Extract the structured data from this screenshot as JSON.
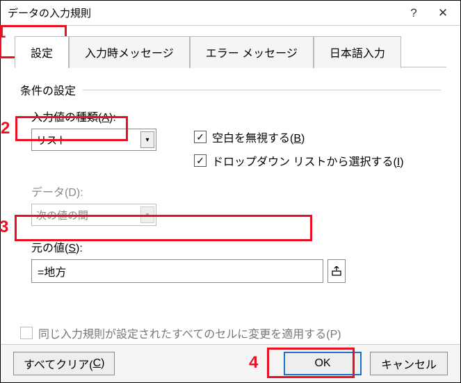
{
  "window": {
    "title": "データの入力規則"
  },
  "tabs": {
    "t1": "設定",
    "t2": "入力時メッセージ",
    "t3": "エラー メッセージ",
    "t4": "日本語入力"
  },
  "fieldset": {
    "legend": "条件の設定",
    "allow_label_pre": "入力値の種類(",
    "allow_label_key": "A",
    "allow_label_post": "):",
    "allow_value": "リスト",
    "data_label_pre": "データ(",
    "data_label_key": "D",
    "data_label_post": "):",
    "data_value": "次の値の間",
    "ignore_blank_pre": "空白を無視する(",
    "ignore_blank_key": "B",
    "ignore_blank_post": ")",
    "dropdown_pre": "ドロップダウン リストから選択する(",
    "dropdown_key": "I",
    "dropdown_post": ")",
    "source_label_pre": "元の値(",
    "source_label_key": "S",
    "source_label_post": "):",
    "source_value": "=地方",
    "apply_pre": "同じ入力規則が設定されたすべてのセルに変更を適用する(",
    "apply_key": "P",
    "apply_post": ")"
  },
  "footer": {
    "clear_pre": "すべてクリア(",
    "clear_key": "C",
    "clear_post": ")",
    "ok": "OK",
    "cancel": "キャンセル"
  },
  "annotations": {
    "n1": "1",
    "n2": "2",
    "n3": "3",
    "n4": "4"
  }
}
